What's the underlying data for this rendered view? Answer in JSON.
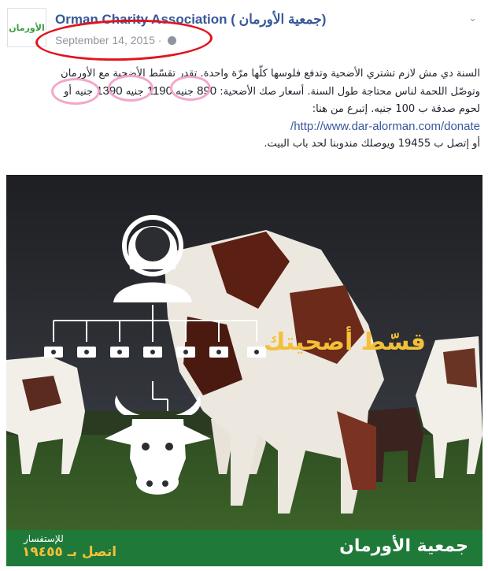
{
  "header": {
    "page_name": "Orman Charity Association ( جمعية الأورمان)",
    "avatar_label": "الأورمان",
    "date": "September 14, 2015",
    "date_separator": "·"
  },
  "post": {
    "line1": "السنة دي مش لازم تشتري الأضحية وتدفع فلوسها كلّها مرّة واحدة. تقدر تقسّط الأضحية مع الأورمان",
    "line2": "وتوصّل اللحمة لناس محتاجة طول السنة. أسعار صك الأضحية:",
    "price1": "890",
    "price2": "1190",
    "price3": "1390",
    "currency": "جنيه",
    "or": "أو",
    "line4": "لحوم صدقة ب 100 جنيه. إتبرع من هنا:",
    "link": "http://www.dar-alorman.com/donate/",
    "line6": "أو إتصل ب 19455 ويوصلك مندوبنا لحد باب البيت."
  },
  "image": {
    "title": "قسّط أضحيتك",
    "call_small": "للإستفسار",
    "call_big": "اتصل بـ ١٩٤٥٥",
    "brand": "جمعية الأورمان"
  },
  "colors": {
    "link": "#365899",
    "annotation_red": "#e0141e",
    "annotation_pink": "#f3a7c9",
    "brand_green": "#1f7a3a",
    "title_gold": "#f4c038"
  }
}
